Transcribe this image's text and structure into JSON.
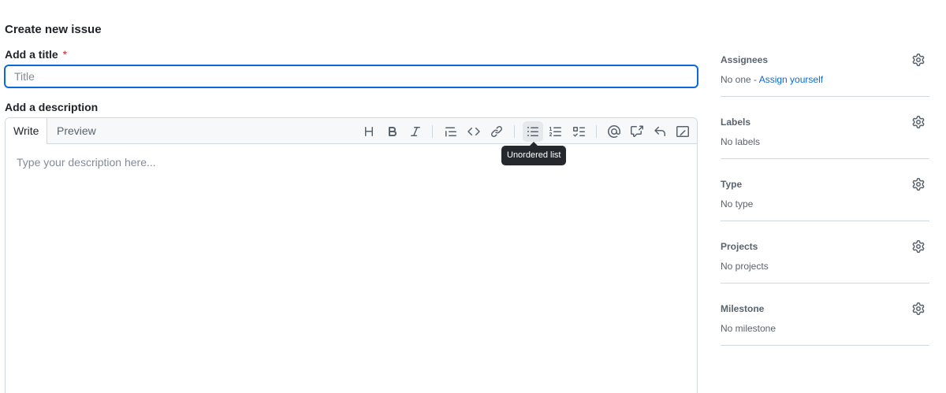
{
  "page": {
    "title": "Create new issue"
  },
  "title_field": {
    "label": "Add a title",
    "required_mark": "*",
    "placeholder": "Title"
  },
  "description": {
    "label": "Add a description",
    "tabs": {
      "write": "Write",
      "preview": "Preview"
    },
    "placeholder": "Type your description here...",
    "toolbar": [
      "heading-icon",
      "bold-icon",
      "italic-icon",
      "quote-icon",
      "code-icon",
      "link-icon",
      "unordered-list-icon",
      "ordered-list-icon",
      "task-list-icon",
      "mention-icon",
      "reference-icon",
      "undo-icon",
      "slash-commands-icon"
    ],
    "tooltip": "Unordered list"
  },
  "sidebar": {
    "assignees": {
      "title": "Assignees",
      "value_prefix": "No one - ",
      "link": "Assign yourself"
    },
    "labels": {
      "title": "Labels",
      "value": "No labels"
    },
    "type": {
      "title": "Type",
      "value": "No type"
    },
    "projects": {
      "title": "Projects",
      "value": "No projects"
    },
    "milestone": {
      "title": "Milestone",
      "value": "No milestone"
    }
  },
  "colors": {
    "accent": "#0969da",
    "required": "#d1242f",
    "tooltip_bg": "#25292e",
    "border": "#d1d9e0"
  }
}
